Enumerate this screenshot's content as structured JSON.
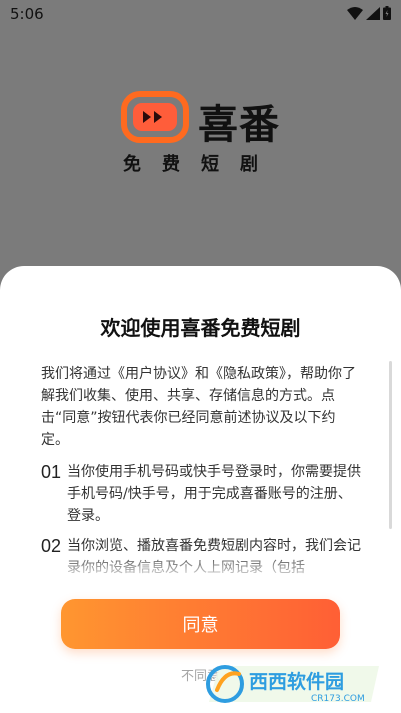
{
  "status_bar": {
    "time": "5:06"
  },
  "brand": {
    "name": "喜番",
    "subtitle": "免费短剧"
  },
  "dialog": {
    "title": "欢迎使用喜番免费短剧",
    "intro": "我们将通过《用户协议》和《隐私政策》，帮助你了解我们收集、使用、共享、存储信息的方式。点击“同意”按钮代表你已经同意前述协议及以下约定。",
    "items": [
      {
        "num": "01",
        "text": "当你使用手机号码或快手号登录时，你需要提供手机号码/快手号，用于完成喜番账号的注册、登录。"
      },
      {
        "num": "02",
        "text": "当你浏览、播放喜番免费短剧内容时，我们会记录你的设备信息及个人上网记录（包括"
      }
    ],
    "agree_label": "同意",
    "decline_label": "不同意"
  },
  "watermark": {
    "text": "西西软件园",
    "url": "CR173.COM"
  },
  "colors": {
    "accent_start": "#ff9630",
    "accent_end": "#ff5f35",
    "overlay": "#7b7b7b"
  }
}
